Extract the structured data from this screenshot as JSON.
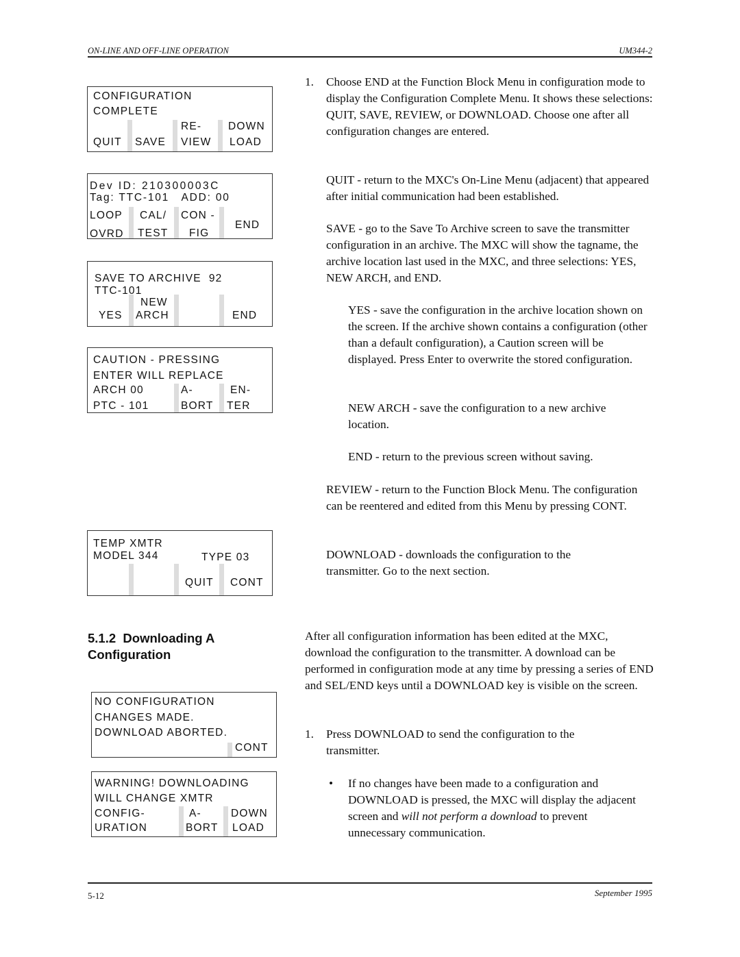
{
  "header": {
    "section_title": "ON-LINE AND OFF-LINE OPERATION",
    "doc_id": "UM344-2"
  },
  "footer": {
    "page_number": "5-12",
    "date": "September 1995"
  },
  "screens": {
    "config_complete": {
      "line1": "CONFIGURATION",
      "line2": "COMPLETE",
      "keys": [
        "QUIT",
        "SAVE",
        "RE-",
        "VIEW",
        "DOWN",
        "LOAD"
      ]
    },
    "online_menu": {
      "line1": "Dev ID: 210300003C",
      "line2": "Tag: TTC-101   ADD: 00",
      "keys": [
        "LOOP",
        "OVRD",
        "CAL/",
        "TEST",
        "CON -",
        "FIG",
        "END"
      ]
    },
    "save_archive": {
      "line1": "SAVE TO ARCHIVE  92",
      "line2": "TTC-101",
      "keys": [
        "YES",
        "NEW",
        "ARCH",
        "END"
      ]
    },
    "caution": {
      "line1": "CAUTION - PRESSING",
      "line2": "ENTER WILL REPLACE",
      "line3": "ARCH 00",
      "line4": "PTC - 101",
      "keys": [
        "A-",
        "BORT",
        "EN-",
        "TER"
      ]
    },
    "temp_xmtr": {
      "line1": "TEMP XMTR",
      "line2": "MODEL 344",
      "type": "TYPE 03",
      "keys": [
        "QUIT",
        "CONT"
      ]
    },
    "no_config": {
      "line1": "NO CONFIGURATION",
      "line2": "CHANGES MADE.",
      "line3": "DOWNLOAD ABORTED.",
      "keys": [
        "CONT"
      ]
    },
    "warning": {
      "line1": "WARNING! DOWNLOADING",
      "line2": "WILL CHANGE XMTR",
      "line3": "CONFIG-",
      "line4": "URATION",
      "keys": [
        "A-",
        "BORT",
        "DOWN",
        "LOAD"
      ]
    }
  },
  "section": {
    "heading_line1": "5.1.2  Downloading A",
    "heading_line2": "Configuration"
  },
  "body": {
    "step1_num": "1.",
    "step1": "Choose END at the Function Block Menu in configuration mode to display the Configuration Complete Menu.  It shows these selections: QUIT, SAVE, REVIEW, or DOWNLOAD. Choose one after all configuration changes are entered.",
    "quit": "QUIT - return to the MXC's On-Line Menu (adjacent) that appeared after initial communication had been established.",
    "save": "SAVE - go to the Save To Archive screen to save the transmitter configuration in an archive.  The MXC will show the tagname, the archive location last used in the MXC, and three selections: YES, NEW ARCH, and END.",
    "yes": "YES - save the configuration in the archive location shown on the screen.  If the archive shown contains a configuration (other than a default configuration), a Caution screen will be displayed.  Press Enter to overwrite the stored configuration.",
    "new_arch": "NEW ARCH - save the configuration to a new archive location.",
    "end": "END - return to the previous screen without saving.",
    "review": "REVIEW - return to the Function Block Menu.  The configuration can be reentered and edited from this Menu by pressing CONT.",
    "download": "DOWNLOAD - downloads the configuration to the transmitter.  Go to the next section.",
    "intro2": "After all configuration information has been edited at the MXC, download the configuration to the transmitter.  A download can be performed in configuration mode at any time by pressing a series of END and SEL/END keys until a DOWNLOAD key is visible on the screen.",
    "step2_num": "1.",
    "step2": "Press DOWNLOAD to send the configuration to the transmitter.",
    "bullet": "•",
    "bullet_pre": "If no changes have been made to a configuration and DOWNLOAD is pressed, the MXC will display the adjacent screen and ",
    "bullet_em": "will not perform a download",
    "bullet_post": " to prevent unnecessary communication."
  }
}
